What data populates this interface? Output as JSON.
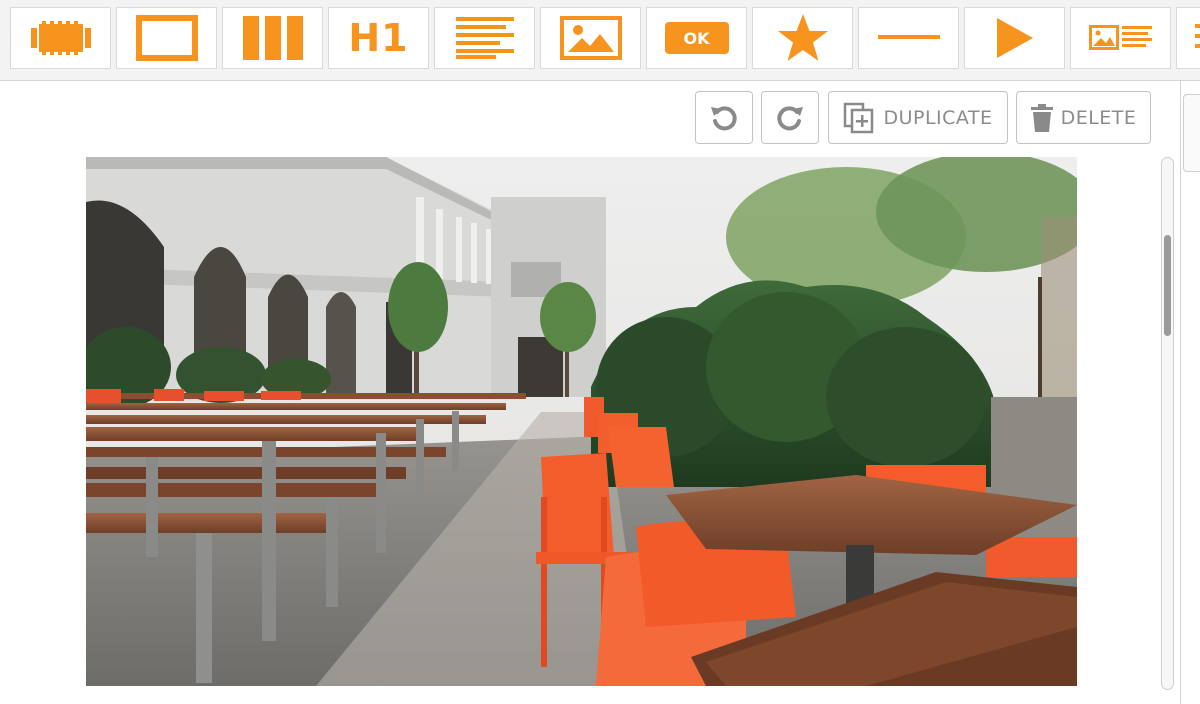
{
  "toolbar": {
    "tools": [
      {
        "name": "section-block-tool",
        "icon": "film-strip-icon"
      },
      {
        "name": "container-block-tool",
        "icon": "rectangle-icon"
      },
      {
        "name": "columns-block-tool",
        "icon": "columns-icon"
      },
      {
        "name": "heading-block-tool",
        "icon": "heading-icon",
        "text": "H1"
      },
      {
        "name": "text-block-tool",
        "icon": "text-lines-icon"
      },
      {
        "name": "image-block-tool",
        "icon": "image-icon"
      },
      {
        "name": "button-block-tool",
        "icon": "button-icon",
        "text": "OK"
      },
      {
        "name": "icon-block-tool",
        "icon": "star-icon"
      },
      {
        "name": "divider-block-tool",
        "icon": "divider-icon"
      },
      {
        "name": "video-block-tool",
        "icon": "play-icon"
      },
      {
        "name": "image-text-block-tool",
        "icon": "image-text-icon"
      },
      {
        "name": "more-block-tool",
        "icon": "text-lines-icon"
      }
    ],
    "accent_color": "#f7941d"
  },
  "actions": {
    "undo_icon": "undo-icon",
    "redo_icon": "redo-icon",
    "duplicate_label": "DUPLICATE",
    "delete_label": "DELETE"
  },
  "scrollbar": {
    "position": 0.1
  },
  "canvas": {
    "image_subject": "outdoor-cafe-photo"
  }
}
